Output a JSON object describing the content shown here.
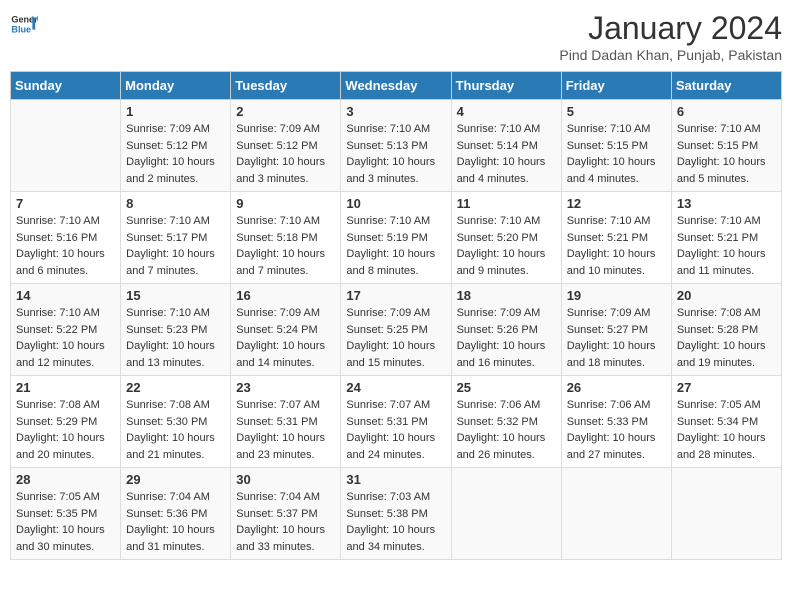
{
  "header": {
    "logo_general": "General",
    "logo_blue": "Blue",
    "month_title": "January 2024",
    "subtitle": "Pind Dadan Khan, Punjab, Pakistan"
  },
  "days_of_week": [
    "Sunday",
    "Monday",
    "Tuesday",
    "Wednesday",
    "Thursday",
    "Friday",
    "Saturday"
  ],
  "weeks": [
    [
      {
        "day": "",
        "info": ""
      },
      {
        "day": "1",
        "info": "Sunrise: 7:09 AM\nSunset: 5:12 PM\nDaylight: 10 hours\nand 2 minutes."
      },
      {
        "day": "2",
        "info": "Sunrise: 7:09 AM\nSunset: 5:12 PM\nDaylight: 10 hours\nand 3 minutes."
      },
      {
        "day": "3",
        "info": "Sunrise: 7:10 AM\nSunset: 5:13 PM\nDaylight: 10 hours\nand 3 minutes."
      },
      {
        "day": "4",
        "info": "Sunrise: 7:10 AM\nSunset: 5:14 PM\nDaylight: 10 hours\nand 4 minutes."
      },
      {
        "day": "5",
        "info": "Sunrise: 7:10 AM\nSunset: 5:15 PM\nDaylight: 10 hours\nand 4 minutes."
      },
      {
        "day": "6",
        "info": "Sunrise: 7:10 AM\nSunset: 5:15 PM\nDaylight: 10 hours\nand 5 minutes."
      }
    ],
    [
      {
        "day": "7",
        "info": "Sunrise: 7:10 AM\nSunset: 5:16 PM\nDaylight: 10 hours\nand 6 minutes."
      },
      {
        "day": "8",
        "info": "Sunrise: 7:10 AM\nSunset: 5:17 PM\nDaylight: 10 hours\nand 7 minutes."
      },
      {
        "day": "9",
        "info": "Sunrise: 7:10 AM\nSunset: 5:18 PM\nDaylight: 10 hours\nand 7 minutes."
      },
      {
        "day": "10",
        "info": "Sunrise: 7:10 AM\nSunset: 5:19 PM\nDaylight: 10 hours\nand 8 minutes."
      },
      {
        "day": "11",
        "info": "Sunrise: 7:10 AM\nSunset: 5:20 PM\nDaylight: 10 hours\nand 9 minutes."
      },
      {
        "day": "12",
        "info": "Sunrise: 7:10 AM\nSunset: 5:21 PM\nDaylight: 10 hours\nand 10 minutes."
      },
      {
        "day": "13",
        "info": "Sunrise: 7:10 AM\nSunset: 5:21 PM\nDaylight: 10 hours\nand 11 minutes."
      }
    ],
    [
      {
        "day": "14",
        "info": "Sunrise: 7:10 AM\nSunset: 5:22 PM\nDaylight: 10 hours\nand 12 minutes."
      },
      {
        "day": "15",
        "info": "Sunrise: 7:10 AM\nSunset: 5:23 PM\nDaylight: 10 hours\nand 13 minutes."
      },
      {
        "day": "16",
        "info": "Sunrise: 7:09 AM\nSunset: 5:24 PM\nDaylight: 10 hours\nand 14 minutes."
      },
      {
        "day": "17",
        "info": "Sunrise: 7:09 AM\nSunset: 5:25 PM\nDaylight: 10 hours\nand 15 minutes."
      },
      {
        "day": "18",
        "info": "Sunrise: 7:09 AM\nSunset: 5:26 PM\nDaylight: 10 hours\nand 16 minutes."
      },
      {
        "day": "19",
        "info": "Sunrise: 7:09 AM\nSunset: 5:27 PM\nDaylight: 10 hours\nand 18 minutes."
      },
      {
        "day": "20",
        "info": "Sunrise: 7:08 AM\nSunset: 5:28 PM\nDaylight: 10 hours\nand 19 minutes."
      }
    ],
    [
      {
        "day": "21",
        "info": "Sunrise: 7:08 AM\nSunset: 5:29 PM\nDaylight: 10 hours\nand 20 minutes."
      },
      {
        "day": "22",
        "info": "Sunrise: 7:08 AM\nSunset: 5:30 PM\nDaylight: 10 hours\nand 21 minutes."
      },
      {
        "day": "23",
        "info": "Sunrise: 7:07 AM\nSunset: 5:31 PM\nDaylight: 10 hours\nand 23 minutes."
      },
      {
        "day": "24",
        "info": "Sunrise: 7:07 AM\nSunset: 5:31 PM\nDaylight: 10 hours\nand 24 minutes."
      },
      {
        "day": "25",
        "info": "Sunrise: 7:06 AM\nSunset: 5:32 PM\nDaylight: 10 hours\nand 26 minutes."
      },
      {
        "day": "26",
        "info": "Sunrise: 7:06 AM\nSunset: 5:33 PM\nDaylight: 10 hours\nand 27 minutes."
      },
      {
        "day": "27",
        "info": "Sunrise: 7:05 AM\nSunset: 5:34 PM\nDaylight: 10 hours\nand 28 minutes."
      }
    ],
    [
      {
        "day": "28",
        "info": "Sunrise: 7:05 AM\nSunset: 5:35 PM\nDaylight: 10 hours\nand 30 minutes."
      },
      {
        "day": "29",
        "info": "Sunrise: 7:04 AM\nSunset: 5:36 PM\nDaylight: 10 hours\nand 31 minutes."
      },
      {
        "day": "30",
        "info": "Sunrise: 7:04 AM\nSunset: 5:37 PM\nDaylight: 10 hours\nand 33 minutes."
      },
      {
        "day": "31",
        "info": "Sunrise: 7:03 AM\nSunset: 5:38 PM\nDaylight: 10 hours\nand 34 minutes."
      },
      {
        "day": "",
        "info": ""
      },
      {
        "day": "",
        "info": ""
      },
      {
        "day": "",
        "info": ""
      }
    ]
  ]
}
